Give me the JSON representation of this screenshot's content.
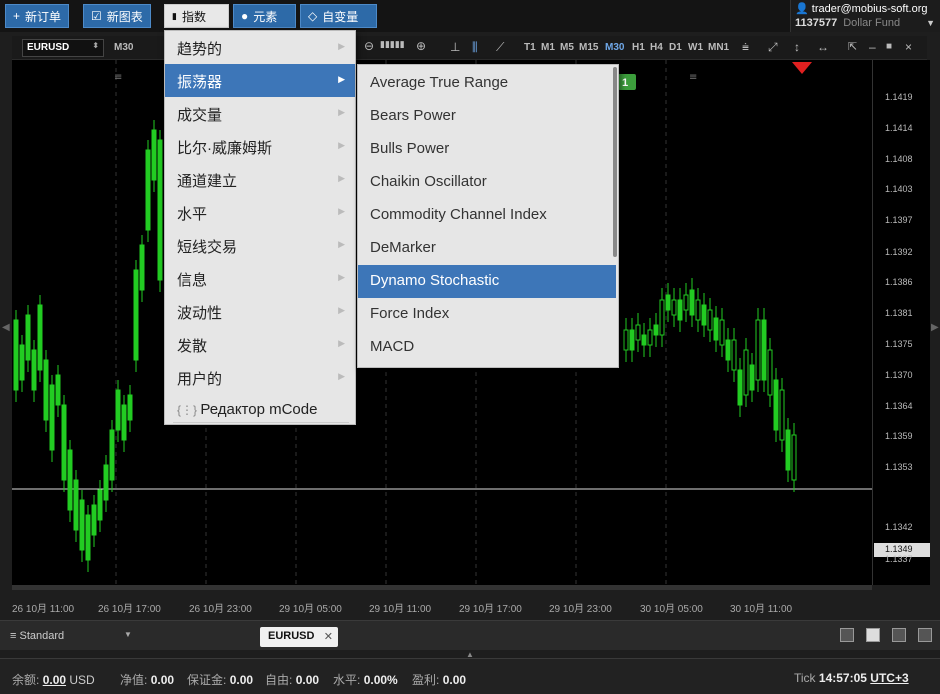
{
  "toolbar": {
    "buttons": [
      {
        "label": "新订单",
        "glyph": "+"
      },
      {
        "label": "新图表",
        "glyph": "☑"
      },
      {
        "label": "指数",
        "glyph": "▮"
      },
      {
        "label": "元素",
        "glyph": "●"
      },
      {
        "label": "自变量",
        "glyph": "◇"
      }
    ]
  },
  "account": {
    "email": "trader@mobius-soft.org",
    "number": "1137577",
    "fund": "Dollar Fund"
  },
  "chart_toolbar": {
    "symbol": "EURUSD",
    "period": "M30",
    "timeframes": [
      "T1",
      "M1",
      "M5",
      "M15",
      "M30",
      "H1",
      "H4",
      "D1",
      "W1",
      "MN1"
    ],
    "selected_timeframe": "M30"
  },
  "chart": {
    "prices": [
      "1.1419",
      "1.1414",
      "1.1408",
      "1.1403",
      "1.1397",
      "1.1392",
      "1.1386",
      "1.1381",
      "1.1375",
      "1.1370",
      "1.1364",
      "1.1359",
      "1.1353",
      "1.1349",
      "1.1342",
      "1.1337"
    ],
    "last_price": "1.1349",
    "times": [
      "26 10月 11:00",
      "26 10月 17:00",
      "26 10月 23:00",
      "29 10月 05:00",
      "29 10月 11:00",
      "29 10月 17:00",
      "29 10月 23:00",
      "30 10月 05:00",
      "30 10月 11:00"
    ],
    "badge": "1",
    "bull_color": "#22cc22",
    "bear_color": "#22cc22"
  },
  "menu": {
    "items": [
      "趋势的",
      "振荡器",
      "成交量",
      "比尔·威廉姆斯",
      "通道建立",
      "水平",
      "短线交易",
      "信息",
      "波动性",
      "发散",
      "用户的"
    ],
    "selected": "振荡器",
    "mcode": "Редактор mCode"
  },
  "submenu": {
    "items": [
      "Average True Range",
      "Bears Power",
      "Bulls Power",
      "Chaikin Oscillator",
      "Commodity Channel Index",
      "DeMarker",
      "Dynamo Stochastic",
      "Force Index",
      "MACD"
    ],
    "selected": "Dynamo Stochastic"
  },
  "tabs": {
    "workspace": "Standard",
    "symbol_tab": "EURUSD"
  },
  "status": {
    "balance_label": "余额:",
    "balance": "0.00",
    "currency": "USD",
    "equity_label": "净值:",
    "equity": "0.00",
    "margin_label": "保证金:",
    "margin": "0.00",
    "free_label": "自由:",
    "free": "0.00",
    "level_label": "水平:",
    "level": "0.00%",
    "profit_label": "盈利:",
    "profit": "0.00",
    "tick_label": "Tick",
    "time": "14:57:05",
    "tz": "UTC+3"
  }
}
